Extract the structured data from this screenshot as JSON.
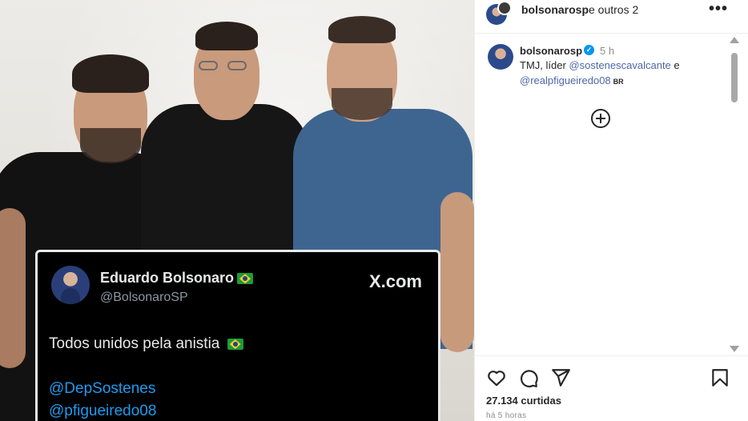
{
  "tweet": {
    "name": "Eduardo Bolsonaro",
    "handle": "@BolsonaroSP",
    "brand": "X.com",
    "text": "Todos unidos pela anistia",
    "mentions": [
      "@DepSostenes",
      "@pfigueiredo08"
    ]
  },
  "ig": {
    "header": {
      "username": "bolsonarosp",
      "rest": "e outros 2",
      "more": "•••"
    },
    "caption": {
      "username": "bolsonarosp",
      "time": "5 h",
      "text_start": "TMJ, líder ",
      "mention1": "@sostenescavalcante",
      "text_mid": " e",
      "mention2": "@realpfigueiredo08",
      "badge": "BR"
    },
    "likes": "27.134 curtidas",
    "ago": "há 5 horas"
  },
  "colors": {
    "ig_mention": "#4c67a8",
    "tweet_mention": "#1d9bf0",
    "verified": "#0095f6",
    "tweet_bg": "#000000"
  },
  "icons": [
    "heart-icon",
    "comment-icon",
    "share-icon",
    "bookmark-icon",
    "plus-circle-icon",
    "more-icon",
    "verified-icon"
  ]
}
